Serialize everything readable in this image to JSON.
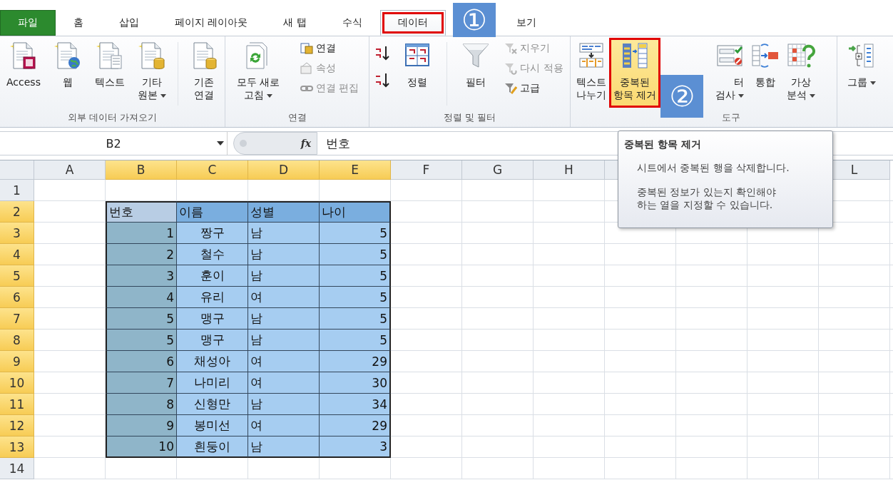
{
  "tabs": [
    {
      "label": "파일",
      "kind": "file",
      "selected": false,
      "annotated": false
    },
    {
      "label": "홈",
      "kind": "tab",
      "selected": false,
      "annotated": false
    },
    {
      "label": "삽입",
      "kind": "tab",
      "selected": false,
      "annotated": false
    },
    {
      "label": "페이지 레이아웃",
      "kind": "tab",
      "selected": false,
      "annotated": false
    },
    {
      "label": "새 탭",
      "kind": "tab",
      "selected": false,
      "annotated": false
    },
    {
      "label": "수식",
      "kind": "tab",
      "selected": false,
      "annotated": false
    },
    {
      "label": "데이터",
      "kind": "tab",
      "selected": true,
      "annotated": true
    },
    {
      "label": "보기",
      "kind": "tab",
      "selected": false,
      "annotated": false
    }
  ],
  "callouts": [
    {
      "label": "①",
      "kind": "tab-row"
    },
    {
      "label": "②",
      "kind": "ribbon"
    }
  ],
  "ribbon": {
    "groups": [
      {
        "label": "외부 데이터 가져오기",
        "covered": false,
        "buttons": [
          {
            "kind": "large",
            "lines": [
              "Access"
            ],
            "has_menu": false,
            "highlighted": false,
            "annotated": false,
            "covered": false
          },
          {
            "kind": "large",
            "lines": [
              "웹"
            ],
            "has_menu": false,
            "highlighted": false,
            "annotated": false,
            "covered": false
          },
          {
            "kind": "large",
            "lines": [
              "텍스트"
            ],
            "has_menu": false,
            "highlighted": false,
            "annotated": false,
            "covered": false
          },
          {
            "kind": "large",
            "lines": [
              "기타",
              "원본"
            ],
            "has_menu": true,
            "highlighted": false,
            "annotated": false,
            "covered": false
          },
          {
            "kind": "large",
            "lines": [
              "기존",
              "연결"
            ],
            "has_menu": false,
            "highlighted": false,
            "annotated": false,
            "covered": false,
            "divider_before": true
          }
        ]
      },
      {
        "label": "연결",
        "covered": false,
        "buttons": [
          {
            "kind": "large",
            "lines": [
              "모두 새로",
              "고침"
            ],
            "has_menu": true,
            "highlighted": false,
            "annotated": false,
            "covered": false
          },
          {
            "kind": "stack",
            "items": [
              {
                "label": "연결",
                "disabled": false
              },
              {
                "label": "속성",
                "disabled": true
              },
              {
                "label": "연결 편집",
                "disabled": true
              }
            ]
          }
        ]
      },
      {
        "label": "정렬 및 필터",
        "covered": false,
        "buttons": [
          {
            "kind": "sort-pair"
          },
          {
            "kind": "large",
            "lines": [
              "정렬"
            ],
            "has_menu": false,
            "highlighted": false,
            "annotated": false,
            "covered": false
          },
          {
            "kind": "large",
            "lines": [
              "필터"
            ],
            "has_menu": false,
            "highlighted": false,
            "annotated": false,
            "covered": false,
            "divider_before": true
          },
          {
            "kind": "stack",
            "items": [
              {
                "label": "지우기",
                "disabled": true
              },
              {
                "label": "다시 적용",
                "disabled": true
              },
              {
                "label": "고급",
                "disabled": false
              }
            ]
          }
        ]
      },
      {
        "label": "도구",
        "covered": true,
        "buttons": [
          {
            "kind": "large",
            "lines": [
              "텍스트",
              "나누기"
            ],
            "has_menu": false,
            "highlighted": false,
            "annotated": false,
            "covered": false
          },
          {
            "kind": "large",
            "lines": [
              "중복된",
              "항목 제거"
            ],
            "has_menu": false,
            "highlighted": true,
            "annotated": true,
            "covered": false
          },
          {
            "kind": "large",
            "lines": [
              "터",
              "검사"
            ],
            "has_menu": true,
            "highlighted": false,
            "annotated": false,
            "covered": true
          },
          {
            "kind": "large",
            "lines": [
              "통합"
            ],
            "has_menu": false,
            "highlighted": false,
            "annotated": false,
            "covered": false
          },
          {
            "kind": "large",
            "lines": [
              "가상",
              "분석"
            ],
            "has_menu": true,
            "highlighted": false,
            "annotated": false,
            "covered": false
          }
        ]
      },
      {
        "buttons": [
          {
            "kind": "large",
            "lines": [
              "그룹"
            ],
            "has_menu": true,
            "highlighted": false,
            "annotated": false,
            "covered": false
          }
        ]
      }
    ]
  },
  "formula_bar": {
    "name_box": "B2",
    "function_label": "fx",
    "value": "번호"
  },
  "tooltip": {
    "title": "중복된 항목 제거",
    "paragraphs": [
      "시트에서 중복된 행을 삭제합니다.",
      "중복된 정보가 있는지 확인해야\n하는 열을 지정할 수 있습니다."
    ]
  },
  "sheet": {
    "columns": [
      {
        "label": "A",
        "selected": false
      },
      {
        "label": "B",
        "selected": true
      },
      {
        "label": "C",
        "selected": true
      },
      {
        "label": "D",
        "selected": true
      },
      {
        "label": "E",
        "selected": true
      },
      {
        "label": "F",
        "selected": false
      },
      {
        "label": "G",
        "selected": false
      },
      {
        "label": "H",
        "selected": false
      },
      {
        "label": "L",
        "selected": false
      }
    ],
    "rows": [
      {
        "header": "1",
        "selected": false
      },
      {
        "header": "2",
        "selected": true,
        "kind": "table-header",
        "cells": [
          "번호",
          "이름",
          "성별",
          "나이"
        ]
      },
      {
        "header": "3",
        "selected": true,
        "kind": "table-row",
        "cells": [
          "1",
          "짱구",
          "남",
          "5"
        ]
      },
      {
        "header": "4",
        "selected": true,
        "kind": "table-row",
        "cells": [
          "2",
          "철수",
          "남",
          "5"
        ]
      },
      {
        "header": "5",
        "selected": true,
        "kind": "table-row",
        "cells": [
          "3",
          "훈이",
          "남",
          "5"
        ]
      },
      {
        "header": "6",
        "selected": true,
        "kind": "table-row",
        "cells": [
          "4",
          "유리",
          "여",
          "5"
        ]
      },
      {
        "header": "7",
        "selected": true,
        "kind": "table-row",
        "cells": [
          "5",
          "맹구",
          "남",
          "5"
        ]
      },
      {
        "header": "8",
        "selected": true,
        "kind": "table-row",
        "cells": [
          "5",
          "맹구",
          "남",
          "5"
        ]
      },
      {
        "header": "9",
        "selected": true,
        "kind": "table-row",
        "cells": [
          "6",
          "채성아",
          "여",
          "29"
        ]
      },
      {
        "header": "10",
        "selected": true,
        "kind": "table-row",
        "cells": [
          "7",
          "나미리",
          "여",
          "30"
        ]
      },
      {
        "header": "11",
        "selected": true,
        "kind": "table-row",
        "cells": [
          "8",
          "신형만",
          "남",
          "34"
        ]
      },
      {
        "header": "12",
        "selected": true,
        "kind": "table-row",
        "cells": [
          "9",
          "봉미선",
          "여",
          "29"
        ]
      },
      {
        "header": "13",
        "selected": true,
        "kind": "table-row",
        "cells": [
          "10",
          "흰둥이",
          "남",
          "3"
        ]
      },
      {
        "header": "14",
        "selected": false
      }
    ]
  }
}
